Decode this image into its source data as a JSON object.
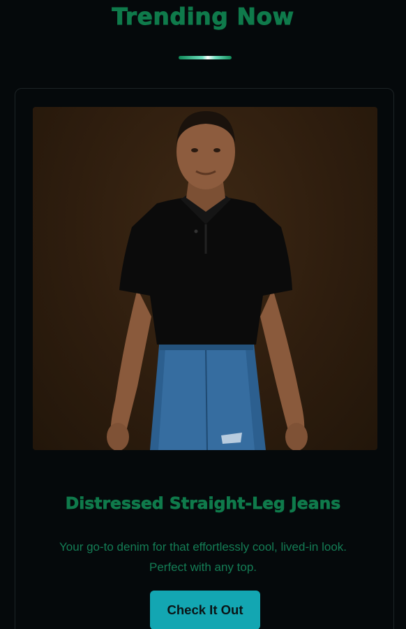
{
  "section": {
    "title": "Trending Now"
  },
  "product": {
    "image_alt": "Man in black polo shirt and blue jeans",
    "title": "Distressed Straight-Leg Jeans",
    "description": "Your go-to denim for that effortlessly cool, lived-in look. Perfect with any top.",
    "cta_label": "Check It Out"
  },
  "colors": {
    "background": "#05090b",
    "accent_green": "#0f7a4b",
    "button_teal": "#13a6b2"
  }
}
